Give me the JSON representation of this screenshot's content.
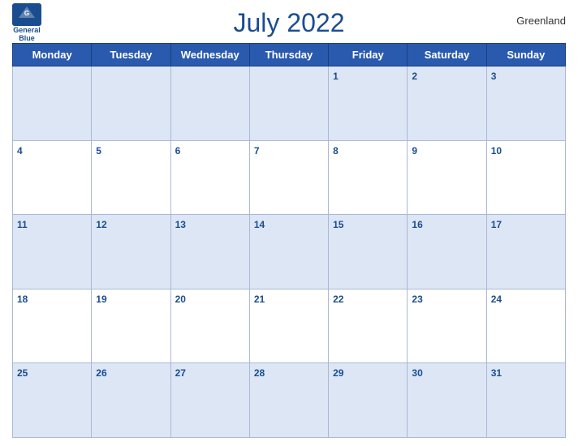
{
  "header": {
    "title": "July 2022",
    "region": "Greenland",
    "logo_line1": "General",
    "logo_line2": "Blue"
  },
  "weekdays": [
    "Monday",
    "Tuesday",
    "Wednesday",
    "Thursday",
    "Friday",
    "Saturday",
    "Sunday"
  ],
  "weeks": [
    [
      {
        "day": "",
        "empty": true
      },
      {
        "day": "",
        "empty": true
      },
      {
        "day": "",
        "empty": true
      },
      {
        "day": "",
        "empty": true
      },
      {
        "day": "1",
        "empty": false
      },
      {
        "day": "2",
        "empty": false
      },
      {
        "day": "3",
        "empty": false
      }
    ],
    [
      {
        "day": "4",
        "empty": false
      },
      {
        "day": "5",
        "empty": false
      },
      {
        "day": "6",
        "empty": false
      },
      {
        "day": "7",
        "empty": false
      },
      {
        "day": "8",
        "empty": false
      },
      {
        "day": "9",
        "empty": false
      },
      {
        "day": "10",
        "empty": false
      }
    ],
    [
      {
        "day": "11",
        "empty": false
      },
      {
        "day": "12",
        "empty": false
      },
      {
        "day": "13",
        "empty": false
      },
      {
        "day": "14",
        "empty": false
      },
      {
        "day": "15",
        "empty": false
      },
      {
        "day": "16",
        "empty": false
      },
      {
        "day": "17",
        "empty": false
      }
    ],
    [
      {
        "day": "18",
        "empty": false
      },
      {
        "day": "19",
        "empty": false
      },
      {
        "day": "20",
        "empty": false
      },
      {
        "day": "21",
        "empty": false
      },
      {
        "day": "22",
        "empty": false
      },
      {
        "day": "23",
        "empty": false
      },
      {
        "day": "24",
        "empty": false
      }
    ],
    [
      {
        "day": "25",
        "empty": false
      },
      {
        "day": "26",
        "empty": false
      },
      {
        "day": "27",
        "empty": false
      },
      {
        "day": "28",
        "empty": false
      },
      {
        "day": "29",
        "empty": false
      },
      {
        "day": "30",
        "empty": false
      },
      {
        "day": "31",
        "empty": false
      }
    ]
  ]
}
